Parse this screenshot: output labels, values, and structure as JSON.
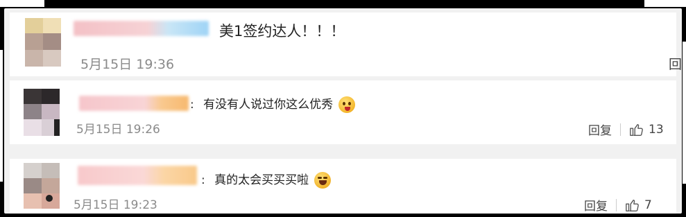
{
  "comments": [
    {
      "text": "美1签约达人！！！",
      "time": "5月15日 19:36",
      "reply_label": "回",
      "like_count": ""
    },
    {
      "prefix": ":",
      "text": "有没有人说过你这么优秀",
      "emoji": "tongue-emoji",
      "time": "5月15日 19:26",
      "reply_label": "回复",
      "like_count": "13"
    },
    {
      "prefix": ":",
      "text": "真的太会买买买啦",
      "emoji": "laughing-crying-emoji",
      "time": "5月15日 19:23",
      "reply_label": "回复",
      "like_count": "7"
    }
  ],
  "colors": {
    "background": "#f1f1f1",
    "card": "#ffffff",
    "time": "#8a8a8a",
    "text": "#222222"
  }
}
